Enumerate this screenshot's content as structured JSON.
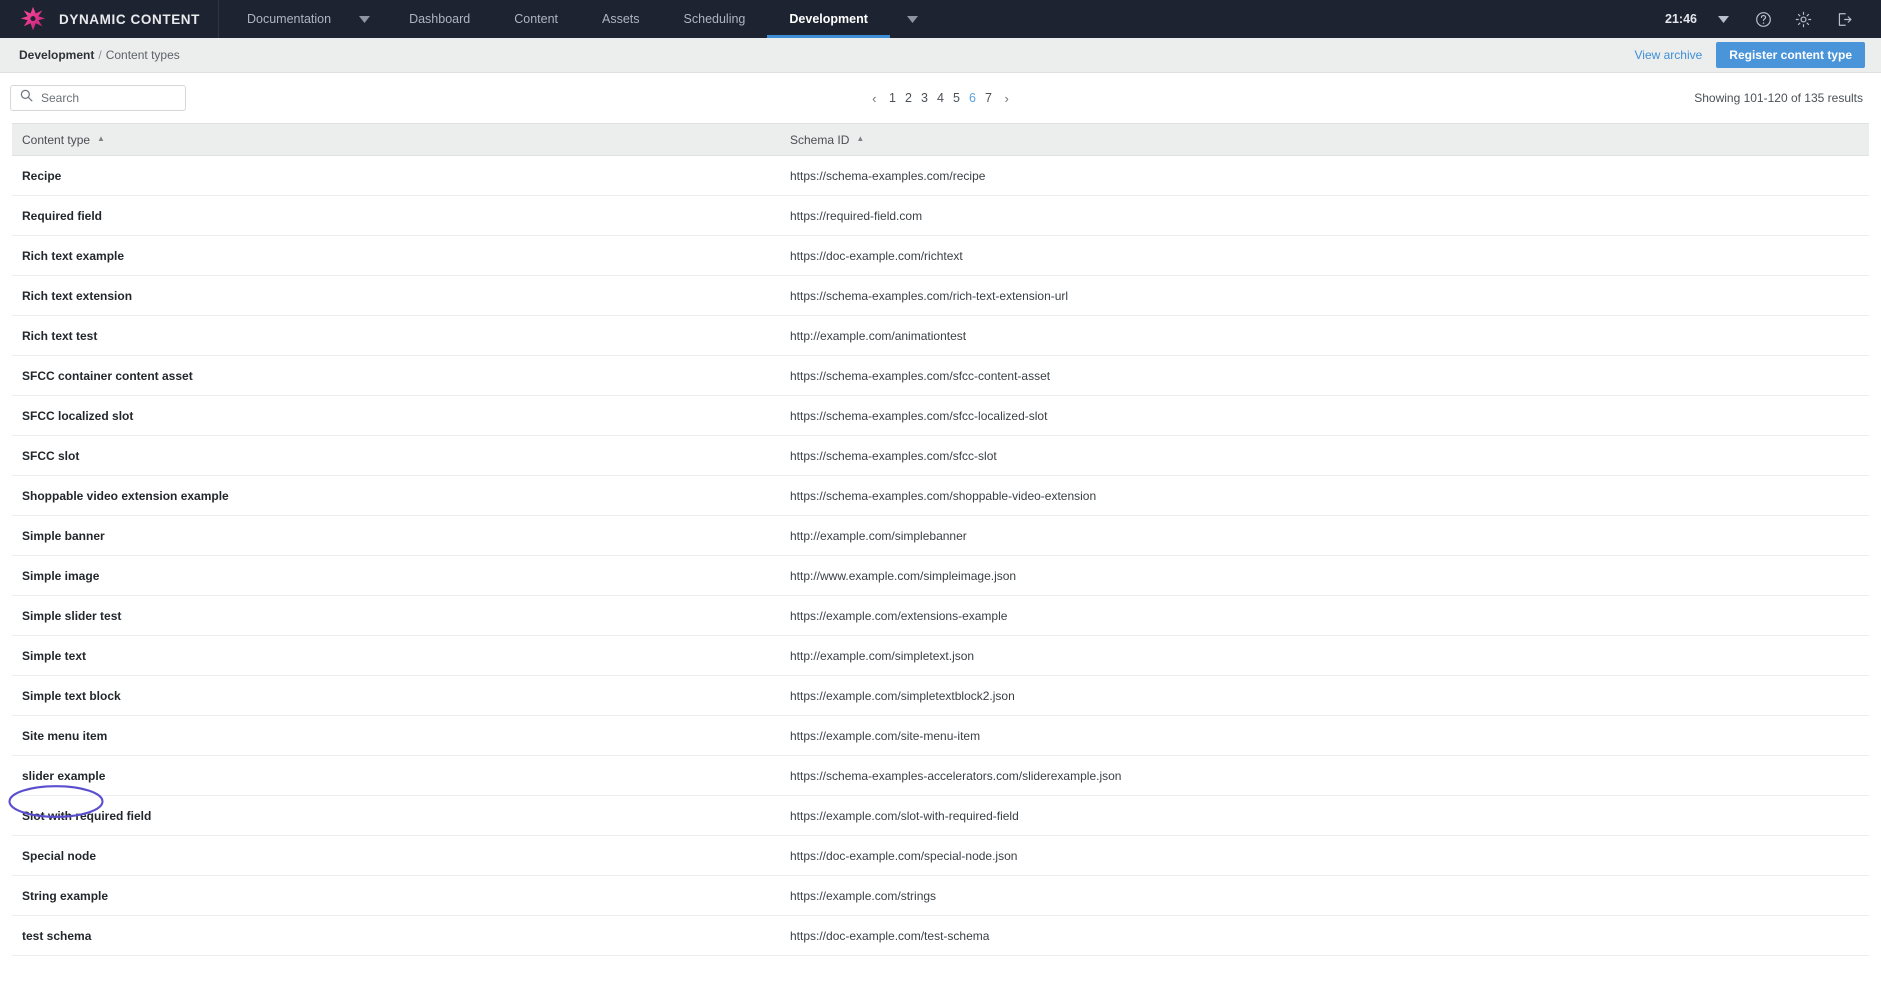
{
  "app": {
    "brand": "DYNAMIC CONTENT",
    "logo_icon": "starburst-logo-icon",
    "accent_blue": "#4a95d9",
    "navbar_bg": "#1d2330",
    "annotation_color": "#5a4fcf"
  },
  "topnav": {
    "items": [
      {
        "label": "Documentation",
        "active": false,
        "has_caret": true
      },
      {
        "label": "Dashboard",
        "active": false,
        "has_caret": false
      },
      {
        "label": "Content",
        "active": false,
        "has_caret": false
      },
      {
        "label": "Assets",
        "active": false,
        "has_caret": false
      },
      {
        "label": "Scheduling",
        "active": false,
        "has_caret": false
      },
      {
        "label": "Development",
        "active": true,
        "has_caret": true
      }
    ],
    "clock": "21:46",
    "icons": [
      {
        "name": "chevron-down-icon"
      },
      {
        "name": "help-icon"
      },
      {
        "name": "gear-icon"
      },
      {
        "name": "logout-icon"
      }
    ]
  },
  "breadcrumb": {
    "root": "Development",
    "separator": "/",
    "current": "Content types"
  },
  "actions": {
    "view_archive": "View archive",
    "register_content_type": "Register content type"
  },
  "search": {
    "placeholder": "Search",
    "value": "",
    "icon": "search-icon"
  },
  "pagination": {
    "prev": "‹",
    "next": "›",
    "pages": [
      "1",
      "2",
      "3",
      "4",
      "5",
      "6",
      "7"
    ],
    "current": "6"
  },
  "results": {
    "summary": "Showing 101-120 of 135 results"
  },
  "table": {
    "columns": [
      {
        "label": "Content type",
        "sort": "asc"
      },
      {
        "label": "Schema ID",
        "sort": "asc"
      }
    ],
    "rows": [
      {
        "content_type": "Recipe",
        "schema_id": "https://schema-examples.com/recipe",
        "annotated": false
      },
      {
        "content_type": "Required field",
        "schema_id": "https://required-field.com",
        "annotated": false
      },
      {
        "content_type": "Rich text example",
        "schema_id": "https://doc-example.com/richtext",
        "annotated": false
      },
      {
        "content_type": "Rich text extension",
        "schema_id": "https://schema-examples.com/rich-text-extension-url",
        "annotated": false
      },
      {
        "content_type": "Rich text test",
        "schema_id": "http://example.com/animationtest",
        "annotated": false
      },
      {
        "content_type": "SFCC container content asset",
        "schema_id": "https://schema-examples.com/sfcc-content-asset",
        "annotated": false
      },
      {
        "content_type": "SFCC localized slot",
        "schema_id": "https://schema-examples.com/sfcc-localized-slot",
        "annotated": false
      },
      {
        "content_type": "SFCC slot",
        "schema_id": "https://schema-examples.com/sfcc-slot",
        "annotated": false
      },
      {
        "content_type": "Shoppable video extension example",
        "schema_id": "https://schema-examples.com/shoppable-video-extension",
        "annotated": false
      },
      {
        "content_type": "Simple banner",
        "schema_id": "http://example.com/simplebanner",
        "annotated": false
      },
      {
        "content_type": "Simple image",
        "schema_id": "http://www.example.com/simpleimage.json",
        "annotated": false
      },
      {
        "content_type": "Simple slider test",
        "schema_id": "https://example.com/extensions-example",
        "annotated": false
      },
      {
        "content_type": "Simple text",
        "schema_id": "http://example.com/simpletext.json",
        "annotated": false
      },
      {
        "content_type": "Simple text block",
        "schema_id": "https://example.com/simpletextblock2.json",
        "annotated": false
      },
      {
        "content_type": "Site menu item",
        "schema_id": "https://example.com/site-menu-item",
        "annotated": false
      },
      {
        "content_type": "slider example",
        "schema_id": "https://schema-examples-accelerators.com/sliderexample.json",
        "annotated": true
      },
      {
        "content_type": "Slot with required field",
        "schema_id": "https://example.com/slot-with-required-field",
        "annotated": false
      },
      {
        "content_type": "Special node",
        "schema_id": "https://doc-example.com/special-node.json",
        "annotated": false
      },
      {
        "content_type": "String example",
        "schema_id": "https://example.com/strings",
        "annotated": false
      },
      {
        "content_type": "test schema",
        "schema_id": "https://doc-example.com/test-schema",
        "annotated": false
      }
    ]
  }
}
